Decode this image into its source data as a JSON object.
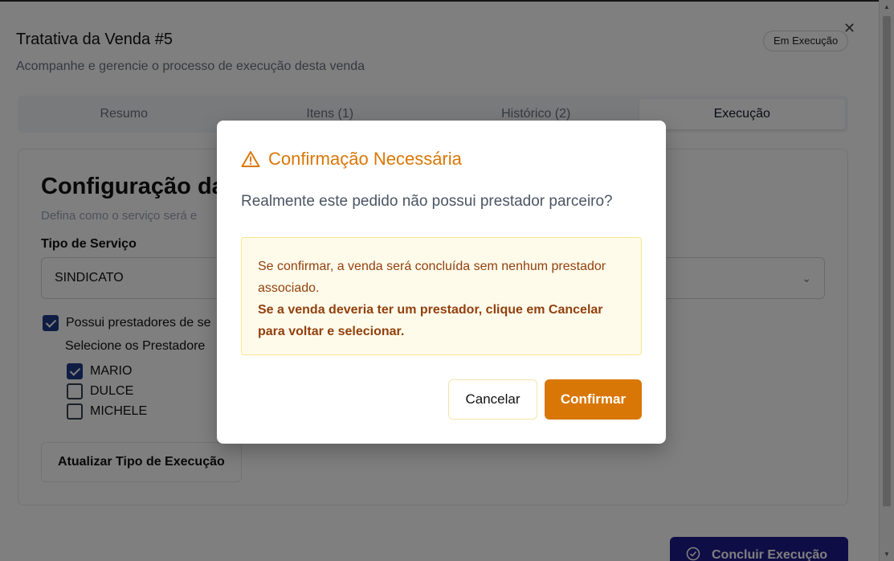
{
  "dialog": {
    "title": "Tratativa da Venda #5",
    "status_badge": "Em Execução",
    "subtitle": "Acompanhe e gerencie o processo de execução desta venda",
    "close_icon": "close-icon"
  },
  "tabs": [
    {
      "label": "Resumo",
      "active": false
    },
    {
      "label": "Itens (1)",
      "active": false
    },
    {
      "label": "Histórico (2)",
      "active": false
    },
    {
      "label": "Execução",
      "active": true
    }
  ],
  "config": {
    "title": "Configuração da",
    "description": "Defina como o serviço será e",
    "service_type_label": "Tipo de Serviço",
    "service_type_value": "SINDICATO",
    "has_providers_label": "Possui prestadores de se",
    "has_providers_checked": true,
    "select_providers_label": "Selecione os Prestadore",
    "providers": [
      {
        "name": "MARIO",
        "checked": true
      },
      {
        "name": "DULCE",
        "checked": false
      },
      {
        "name": "MICHELE",
        "checked": false
      }
    ],
    "update_button": "Atualizar Tipo de Execução"
  },
  "footer": {
    "finish_button": "Concluir Execução",
    "finish_icon": "check-circle-icon"
  },
  "modal": {
    "title": "Confirmação Necessária",
    "icon": "warning-icon",
    "question": "Realmente este pedido não possui prestador parceiro?",
    "alert_text": "Se confirmar, a venda será concluída sem nenhum prestador associado.",
    "alert_strong": "Se a venda deveria ter um prestador, clique em Cancelar para voltar e selecionar.",
    "cancel_button": "Cancelar",
    "confirm_button": "Confirmar",
    "accent_color": "#d97706"
  }
}
